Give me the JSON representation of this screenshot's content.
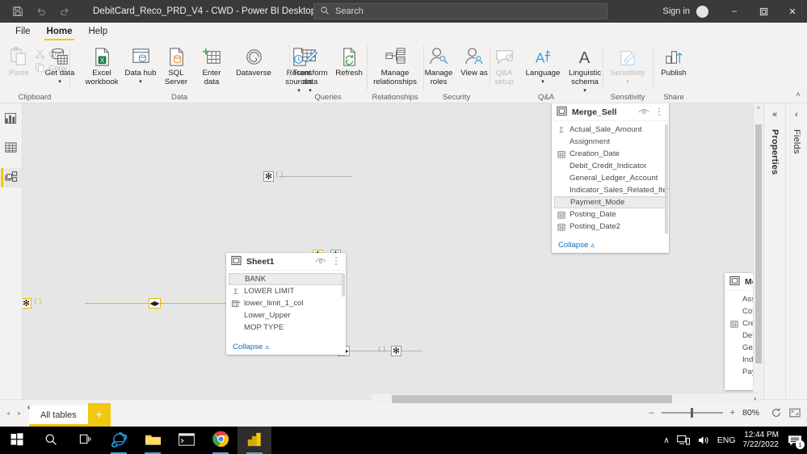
{
  "titlebar": {
    "save_icon": "save-icon",
    "undo_icon": "undo-icon",
    "redo_icon": "redo-icon",
    "title": "DebitCard_Reco_PRD_V4 - CWD - Power BI Desktop",
    "search_placeholder": "Search",
    "search_icon": "search-icon",
    "sign_in": "Sign in",
    "minimize": "–",
    "restore": "❐",
    "close": "✕"
  },
  "ribbon": {
    "tabs": [
      {
        "label": "File",
        "active": false
      },
      {
        "label": "Home",
        "active": true
      },
      {
        "label": "Help",
        "active": false
      }
    ],
    "groups": [
      {
        "label": "Clipboard",
        "items": [
          {
            "label": "Paste",
            "icon": "paste-icon",
            "disabled": true
          },
          {
            "label": "Cut",
            "icon": "cut-icon",
            "disabled": true
          },
          {
            "label": "Copy",
            "icon": "copy-icon",
            "disabled": true
          }
        ]
      },
      {
        "label": "Data",
        "items": [
          {
            "label": "Get data",
            "icon": "get-data-icon",
            "caret": true
          },
          {
            "label": "Excel workbook",
            "icon": "excel-workbook-icon",
            "caret": false
          },
          {
            "label": "Data hub",
            "icon": "data-hub-icon",
            "caret": true
          },
          {
            "label": "SQL Server",
            "icon": "sql-server-icon",
            "caret": false
          },
          {
            "label": "Enter data",
            "icon": "enter-data-icon",
            "caret": false
          },
          {
            "label": "Dataverse",
            "icon": "dataverse-icon",
            "caret": false
          },
          {
            "label": "Recent sources",
            "icon": "recent-sources-icon",
            "caret": true
          }
        ]
      },
      {
        "label": "Queries",
        "items": [
          {
            "label": "Transform data",
            "icon": "transform-data-icon",
            "caret": true
          },
          {
            "label": "Refresh",
            "icon": "refresh-icon",
            "caret": false
          }
        ]
      },
      {
        "label": "Relationships",
        "items": [
          {
            "label": "Manage relationships",
            "icon": "manage-relationships-icon",
            "caret": false
          }
        ]
      },
      {
        "label": "Security",
        "items": [
          {
            "label": "Manage roles",
            "icon": "manage-roles-icon",
            "caret": false
          },
          {
            "label": "View as",
            "icon": "view-as-icon",
            "caret": false
          }
        ]
      },
      {
        "label": "Q&A",
        "items": [
          {
            "label": "Q&A setup",
            "icon": "qa-setup-icon",
            "caret": false,
            "disabled": true
          },
          {
            "label": "Language",
            "icon": "language-icon",
            "caret": true
          },
          {
            "label": "Linguistic schema",
            "icon": "linguistic-schema-icon",
            "caret": true
          }
        ]
      },
      {
        "label": "Sensitivity",
        "items": [
          {
            "label": "Sensitivity",
            "icon": "sensitivity-icon",
            "caret": true,
            "disabled": true
          }
        ]
      },
      {
        "label": "Share",
        "items": [
          {
            "label": "Publish",
            "icon": "publish-icon",
            "caret": false
          }
        ]
      }
    ],
    "collapse_caret": "˄"
  },
  "view_rail": [
    {
      "name": "report-view",
      "icon": "report-chart-icon",
      "selected": false
    },
    {
      "name": "data-view",
      "icon": "data-table-icon",
      "selected": false
    },
    {
      "name": "model-view",
      "icon": "model-diagram-icon",
      "selected": true
    }
  ],
  "canvas": {
    "tables": [
      {
        "name": "Merge_Sell",
        "title": "Merge_Sell",
        "eye_icon": "hide-eye-icon",
        "menu_icon": "more-options-icon",
        "collapse_label": "Collapse",
        "collapse_caret": "⌃",
        "has_scrollbar": true,
        "fields": [
          {
            "label": "Actual_Sale_Amount",
            "icon": "sigma-icon",
            "selected": false
          },
          {
            "label": "Assignment",
            "icon": "none",
            "selected": false
          },
          {
            "label": "Creation_Date",
            "icon": "calendar-icon",
            "selected": false
          },
          {
            "label": "Debit_Credit_Indicator",
            "icon": "none",
            "selected": false
          },
          {
            "label": "General_Ledger_Account",
            "icon": "none",
            "selected": false
          },
          {
            "label": "Indicator_Sales_Related_Item",
            "icon": "none",
            "selected": false
          },
          {
            "label": "Payment_Mode",
            "icon": "none",
            "selected": true
          },
          {
            "label": "Posting_Date",
            "icon": "calendar-icon",
            "selected": false
          },
          {
            "label": "Posting_Date2",
            "icon": "calendar-icon",
            "selected": false
          }
        ]
      },
      {
        "name": "Sheet1",
        "title": "Sheet1",
        "eye_icon": "hide-eye-icon",
        "menu_icon": "more-options-icon",
        "collapse_label": "Collapse",
        "collapse_caret": "⌃",
        "has_scrollbar": true,
        "fields": [
          {
            "label": "BANK",
            "icon": "none",
            "selected": true
          },
          {
            "label": "LOWER LIMIT",
            "icon": "sigma-icon",
            "selected": false
          },
          {
            "label": "lower_limit_1_col",
            "icon": "calculated-column-icon",
            "selected": false
          },
          {
            "label": "Lower_Upper",
            "icon": "none",
            "selected": false
          },
          {
            "label": "MOP TYPE",
            "icon": "none",
            "selected": false
          }
        ]
      },
      {
        "name": "Merge-right-clipped",
        "title": "Mer",
        "eye_icon": "",
        "menu_icon": "",
        "collapse_label": "",
        "collapse_caret": "",
        "has_scrollbar": false,
        "fields": [
          {
            "label": "Assig",
            "icon": "none",
            "selected": false
          },
          {
            "label": "Cost_",
            "icon": "none",
            "selected": false
          },
          {
            "label": "Creat",
            "icon": "calendar-icon",
            "selected": false
          },
          {
            "label": "Debit",
            "icon": "none",
            "selected": false
          },
          {
            "label": "Gene",
            "icon": "none",
            "selected": false
          },
          {
            "label": "Indic",
            "icon": "none",
            "selected": false
          },
          {
            "label": "Paym",
            "icon": "none",
            "selected": false
          }
        ]
      }
    ],
    "relationships": [
      {
        "name": "sheet1-to-merge-sell",
        "highlighted": true,
        "cardinality_left": "✻",
        "cardinality_right": "✻",
        "cross_filter": "◀▶"
      },
      {
        "name": "merge-sell-to-merge-right",
        "highlighted": false,
        "cardinality_left": "✻",
        "cardinality_right": "✻",
        "cross_filter": "◀▶"
      },
      {
        "name": "merge-sell-right-edge",
        "highlighted": false,
        "cardinality_left": "✻",
        "cardinality_right": "",
        "cross_filter": ""
      }
    ],
    "scroll_up": "˄",
    "scroll_down": "˅",
    "scroll_left": "‹",
    "scroll_right": "›"
  },
  "right_panes": [
    {
      "name": "properties-pane",
      "title": "Properties",
      "chevron": "«"
    },
    {
      "name": "fields-pane",
      "title": "Fields",
      "chevron": "‹"
    }
  ],
  "bottom_bar": {
    "collapse_arrow": "‹",
    "prev_arrow": "◂",
    "next_arrow": "▸",
    "tabs": [
      {
        "label": "All tables",
        "active": true
      }
    ],
    "add_tab": "+",
    "zoom_minus": "–",
    "zoom_plus": "+",
    "zoom_percent": "80%",
    "fit_icon": "reset-zoom-icon",
    "focus_icon": "fit-to-page-icon"
  },
  "taskbar": {
    "items": [
      {
        "name": "start-button",
        "icon": "windows-logo-icon",
        "active": false,
        "running": false
      },
      {
        "name": "search-button",
        "icon": "search-icon",
        "active": false,
        "running": false
      },
      {
        "name": "task-view-button",
        "icon": "task-view-icon",
        "active": false,
        "running": false
      },
      {
        "name": "internet-explorer-button",
        "icon": "internet-explorer-icon",
        "active": false,
        "running": true
      },
      {
        "name": "file-explorer-button",
        "icon": "file-explorer-icon",
        "active": false,
        "running": true
      },
      {
        "name": "terminal-button",
        "icon": "command-prompt-icon",
        "active": false,
        "running": false
      },
      {
        "name": "chrome-button",
        "icon": "chrome-icon",
        "active": false,
        "running": true
      },
      {
        "name": "power-bi-button",
        "icon": "power-bi-icon",
        "active": true,
        "running": true
      }
    ],
    "tray": {
      "chevron": "∧",
      "network_icon": "network-icon",
      "volume_icon": "volume-icon",
      "language": "ENG",
      "time": "12:44 PM",
      "date": "7/22/2022",
      "notification_icon": "notifications-icon",
      "notification_count": "1"
    }
  }
}
